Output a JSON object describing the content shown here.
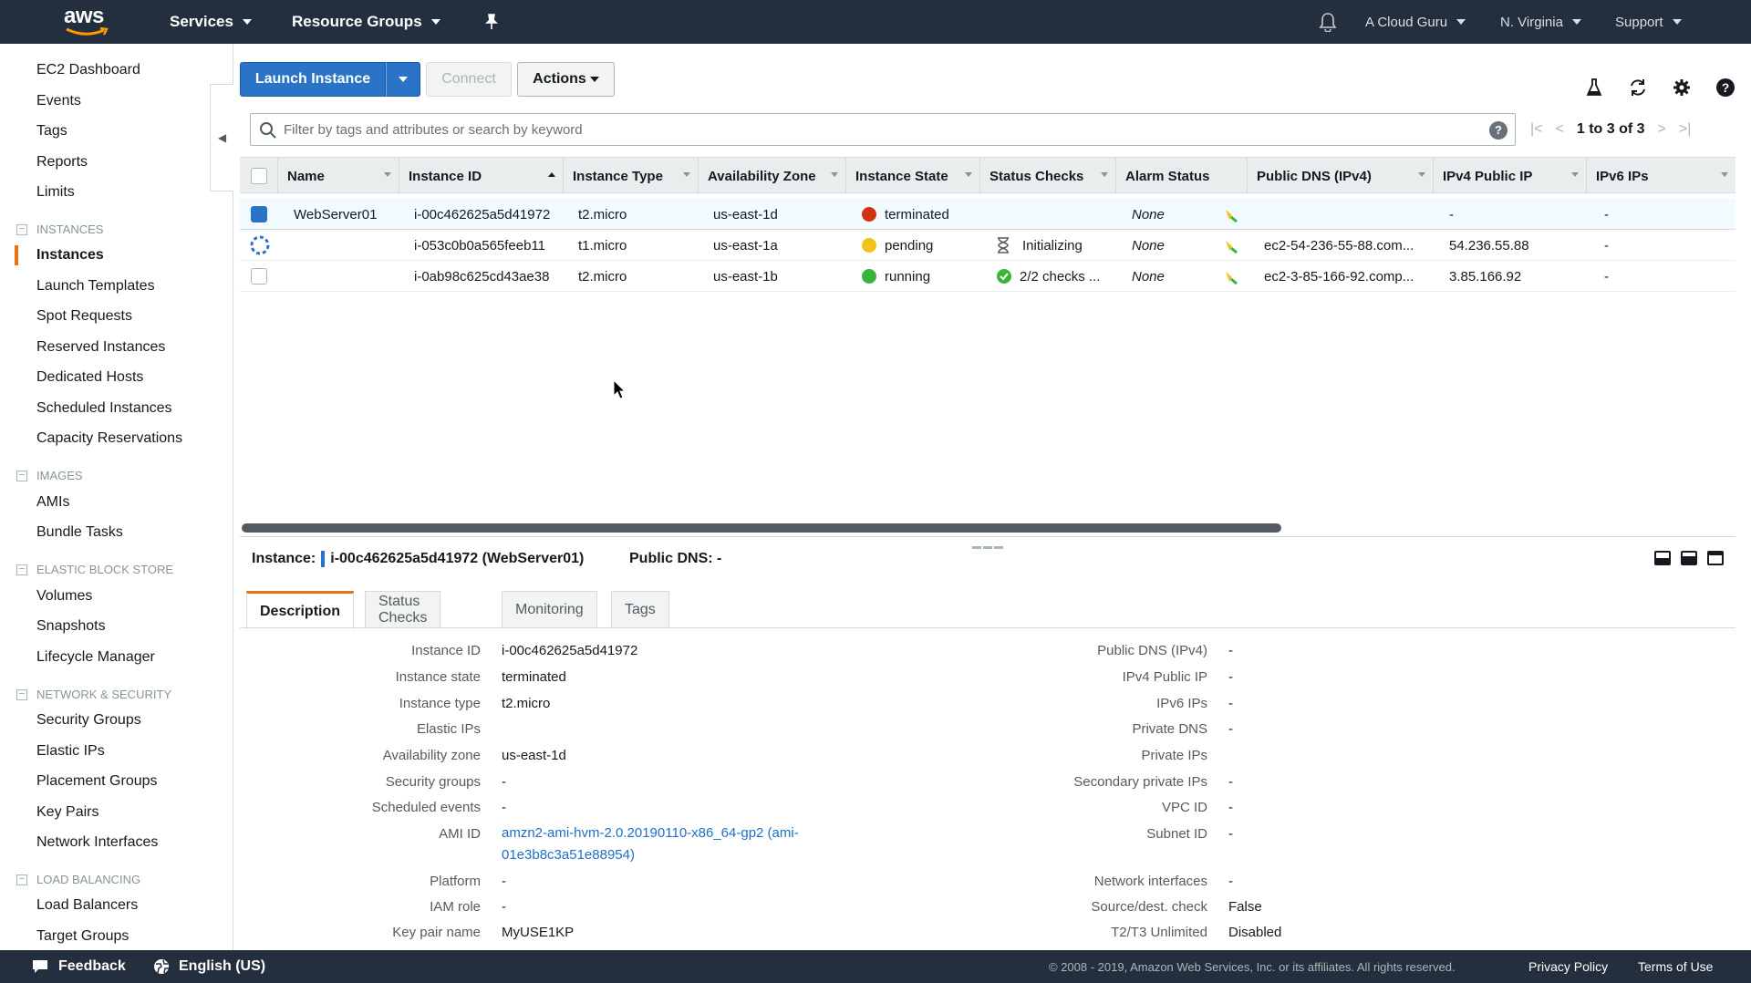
{
  "topnav": {
    "logo_text": "aws",
    "services": "Services",
    "resource_groups": "Resource Groups",
    "account": "A Cloud Guru",
    "region": "N. Virginia",
    "support": "Support"
  },
  "sidebar": {
    "top_links": [
      "EC2 Dashboard",
      "Events",
      "Tags",
      "Reports",
      "Limits"
    ],
    "sections": [
      {
        "title": "INSTANCES",
        "items": [
          "Instances",
          "Launch Templates",
          "Spot Requests",
          "Reserved Instances",
          "Dedicated Hosts",
          "Scheduled Instances",
          "Capacity Reservations"
        ]
      },
      {
        "title": "IMAGES",
        "items": [
          "AMIs",
          "Bundle Tasks"
        ]
      },
      {
        "title": "ELASTIC BLOCK STORE",
        "items": [
          "Volumes",
          "Snapshots",
          "Lifecycle Manager"
        ]
      },
      {
        "title": "NETWORK & SECURITY",
        "items": [
          "Security Groups",
          "Elastic IPs",
          "Placement Groups",
          "Key Pairs",
          "Network Interfaces"
        ]
      },
      {
        "title": "LOAD BALANCING",
        "items": [
          "Load Balancers",
          "Target Groups"
        ]
      }
    ],
    "active_item": "Instances"
  },
  "toolbar": {
    "launch_label": "Launch Instance",
    "connect_label": "Connect",
    "actions_label": "Actions"
  },
  "filter": {
    "placeholder": "Filter by tags and attributes or search by keyword",
    "pager_text": "1 to 3 of 3"
  },
  "table": {
    "columns": [
      "Name",
      "Instance ID",
      "Instance Type",
      "Availability Zone",
      "Instance State",
      "Status Checks",
      "Alarm Status",
      "Public DNS (IPv4)",
      "IPv4 Public IP",
      "IPv6 IPs"
    ],
    "rows": [
      {
        "name": "WebServer01",
        "id": "i-00c462625a5d41972",
        "type": "t2.micro",
        "az": "us-east-1d",
        "state": "terminated",
        "state_color": "#d13212",
        "checks": "",
        "alarm": "None",
        "dns": "",
        "ipv4": "-",
        "ipv6": "-",
        "selected": true
      },
      {
        "name": "",
        "id": "i-053c0b0a565feeb11",
        "type": "t1.micro",
        "az": "us-east-1a",
        "state": "pending",
        "state_color": "#f2c316",
        "checks": "Initializing",
        "alarm": "None",
        "dns": "ec2-54-236-55-88.com...",
        "ipv4": "54.236.55.88",
        "ipv6": "-",
        "selected": false
      },
      {
        "name": "",
        "id": "i-0ab98c625cd43ae38",
        "type": "t2.micro",
        "az": "us-east-1b",
        "state": "running",
        "state_color": "#3bb43b",
        "checks": "2/2 checks ...",
        "alarm": "None",
        "dns": "ec2-3-85-166-92.comp...",
        "ipv4": "3.85.166.92",
        "ipv6": "-",
        "selected": false
      }
    ]
  },
  "detail": {
    "instance_label": "Instance:",
    "instance_value": "i-00c462625a5d41972 (WebServer01)",
    "dns_label": "Public DNS:",
    "dns_value": "-",
    "tabs": [
      "Description",
      "Status Checks",
      "Monitoring",
      "Tags"
    ],
    "left": [
      {
        "label": "Instance ID",
        "value": "i-00c462625a5d41972"
      },
      {
        "label": "Instance state",
        "value": "terminated"
      },
      {
        "label": "Instance type",
        "value": "t2.micro"
      },
      {
        "label": "Elastic IPs",
        "value": ""
      },
      {
        "label": "Availability zone",
        "value": "us-east-1d"
      },
      {
        "label": "Security groups",
        "value": "-"
      },
      {
        "label": "Scheduled events",
        "value": "-"
      },
      {
        "label": "AMI ID",
        "value": "amzn2-ami-hvm-2.0.20190110-x86_64-gp2 (ami-01e3b8c3a51e88954)"
      },
      {
        "label": "Platform",
        "value": "-"
      },
      {
        "label": "IAM role",
        "value": "-"
      },
      {
        "label": "Key pair name",
        "value": "MyUSE1KP"
      }
    ],
    "right": [
      {
        "label": "Public DNS (IPv4)",
        "value": "-"
      },
      {
        "label": "IPv4 Public IP",
        "value": "-"
      },
      {
        "label": "IPv6 IPs",
        "value": "-"
      },
      {
        "label": "Private DNS",
        "value": "-"
      },
      {
        "label": "Private IPs",
        "value": ""
      },
      {
        "label": "Secondary private IPs",
        "value": "-"
      },
      {
        "label": "VPC ID",
        "value": "-"
      },
      {
        "label": "Subnet ID",
        "value": "-"
      },
      {
        "label": "Network interfaces",
        "value": "-"
      },
      {
        "label": "Source/dest. check",
        "value": "False"
      },
      {
        "label": "T2/T3 Unlimited",
        "value": "Disabled"
      }
    ]
  },
  "footer": {
    "feedback": "Feedback",
    "language": "English (US)",
    "copyright": "© 2008 - 2019, Amazon Web Services, Inc. or its affiliates. All rights reserved.",
    "privacy": "Privacy Policy",
    "terms": "Terms of Use"
  }
}
